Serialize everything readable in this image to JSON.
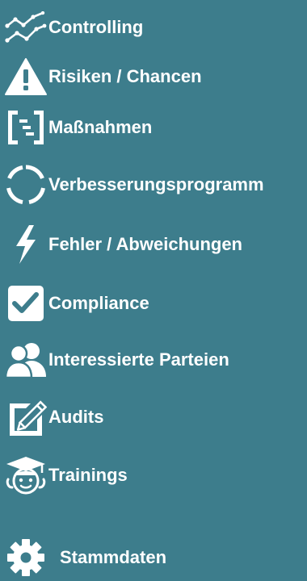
{
  "sidebar": {
    "items": [
      {
        "label": "Controlling",
        "icon": "line-chart-icon"
      },
      {
        "label": "Risiken / Chancen",
        "icon": "warning-triangle-icon"
      },
      {
        "label": "Maßnahmen",
        "icon": "tasks-bracket-icon"
      },
      {
        "label": "Verbesserungsprogramm",
        "icon": "circle-notch-icon"
      },
      {
        "label": "Fehler / Abweichungen",
        "icon": "lightning-bolt-icon"
      },
      {
        "label": "Compliance",
        "icon": "checkbox-checked-icon"
      },
      {
        "label": "Interessierte Parteien",
        "icon": "users-icon"
      },
      {
        "label": "Audits",
        "icon": "edit-pencil-icon"
      },
      {
        "label": "Trainings",
        "icon": "graduate-student-icon"
      },
      {
        "label": "Stammdaten",
        "icon": "gear-icon"
      }
    ]
  },
  "colors": {
    "background": "#3d7d8c",
    "foreground": "#ffffff"
  }
}
